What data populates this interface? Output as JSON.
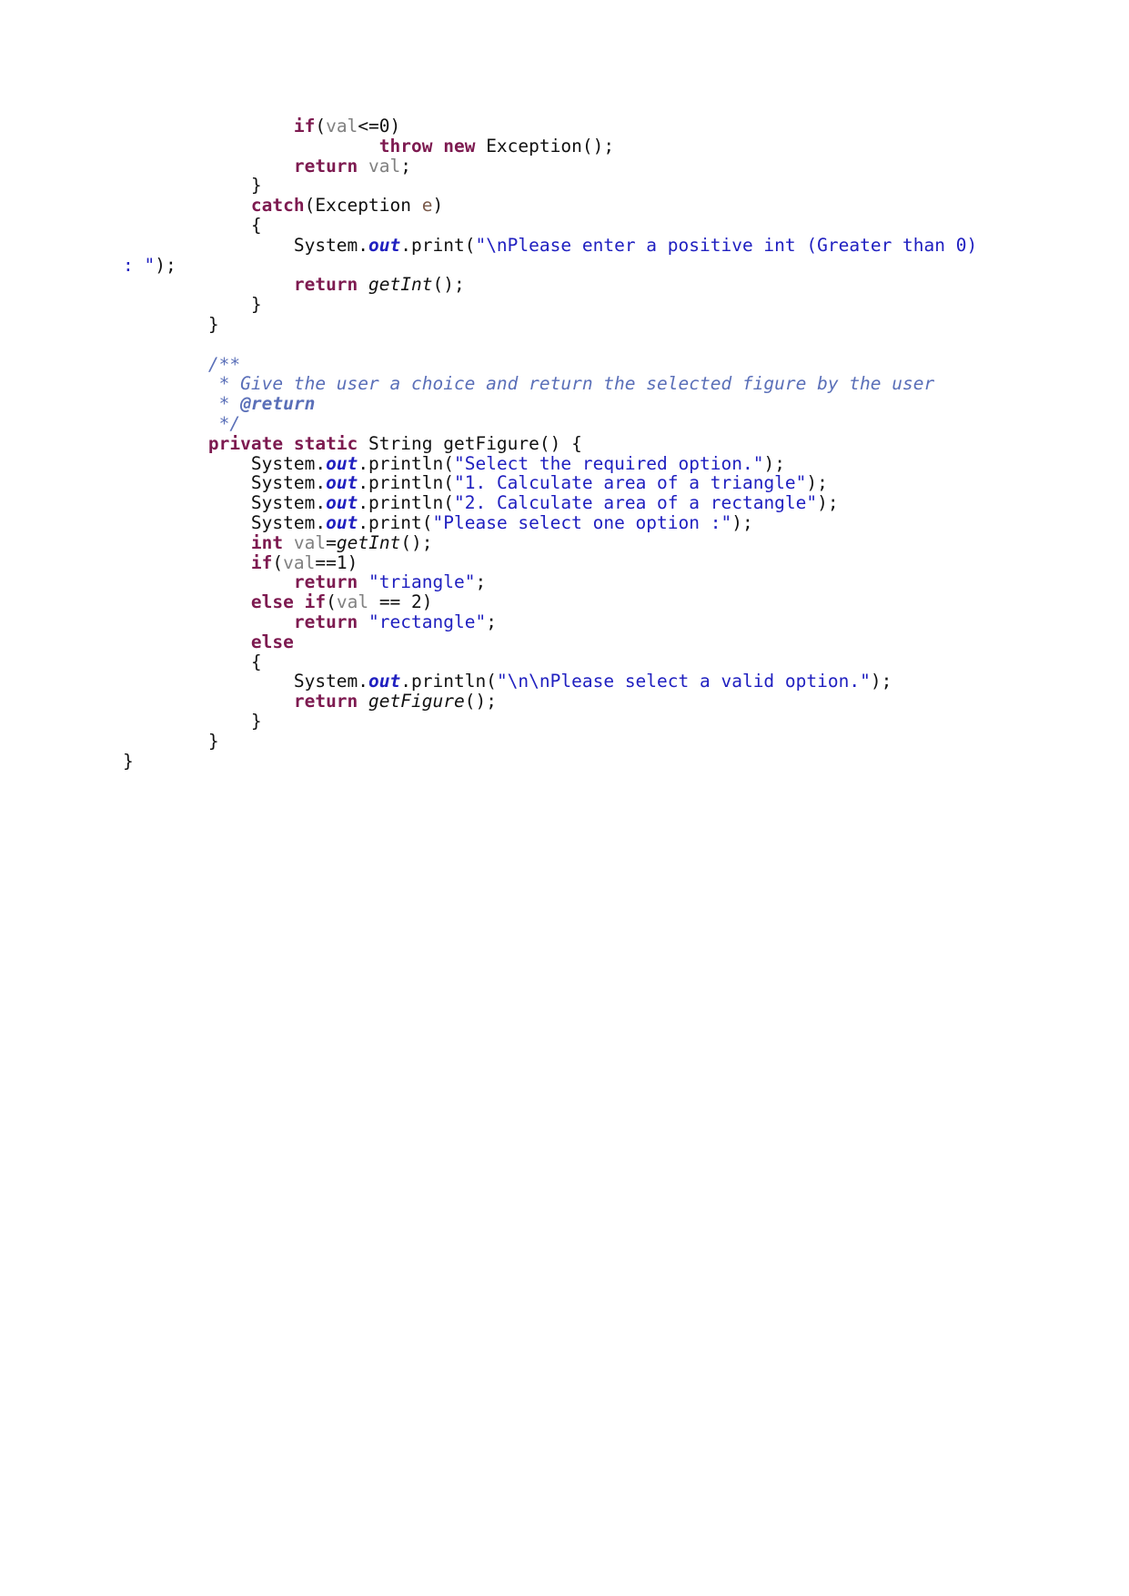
{
  "document": {
    "language": "java",
    "background_color": "#ffffff",
    "colors": {
      "keyword": "#7d1a50",
      "string": "#2020c0",
      "comment": "#5a6fb8",
      "identifier": "#808080",
      "plain": "#111111",
      "static_field": "#2020c0",
      "parameter": "#7a5a4a"
    }
  },
  "code": {
    "lines": [
      {
        "indent": 16,
        "tokens": [
          {
            "t": "if",
            "c": "kw"
          },
          {
            "t": "(",
            "c": "plain"
          },
          {
            "t": "val",
            "c": "id"
          },
          {
            "t": "<=0)",
            "c": "plain"
          }
        ]
      },
      {
        "indent": 24,
        "tokens": [
          {
            "t": "throw",
            "c": "kw"
          },
          {
            "t": " ",
            "c": "plain"
          },
          {
            "t": "new",
            "c": "kw"
          },
          {
            "t": " Exception();",
            "c": "plain"
          }
        ]
      },
      {
        "indent": 16,
        "tokens": [
          {
            "t": "return",
            "c": "kw"
          },
          {
            "t": " ",
            "c": "plain"
          },
          {
            "t": "val",
            "c": "id"
          },
          {
            "t": ";",
            "c": "plain"
          }
        ]
      },
      {
        "indent": 12,
        "tokens": [
          {
            "t": "}",
            "c": "plain"
          }
        ]
      },
      {
        "indent": 12,
        "tokens": [
          {
            "t": "catch",
            "c": "kw"
          },
          {
            "t": "(Exception ",
            "c": "plain"
          },
          {
            "t": "e",
            "c": "param"
          },
          {
            "t": ")",
            "c": "plain"
          }
        ]
      },
      {
        "indent": 12,
        "tokens": [
          {
            "t": "{",
            "c": "plain"
          }
        ]
      },
      {
        "indent": 16,
        "tokens": [
          {
            "t": "System.",
            "c": "plain"
          },
          {
            "t": "out",
            "c": "out"
          },
          {
            "t": ".print(",
            "c": "plain"
          },
          {
            "t": "\"\\nPlease enter a positive int (Greater than 0) : \"",
            "c": "str"
          },
          {
            "t": ");",
            "c": "plain"
          }
        ]
      },
      {
        "indent": 16,
        "tokens": [
          {
            "t": "return",
            "c": "kw"
          },
          {
            "t": " ",
            "c": "plain"
          },
          {
            "t": "getInt",
            "c": "mth"
          },
          {
            "t": "();",
            "c": "plain"
          }
        ]
      },
      {
        "indent": 12,
        "tokens": [
          {
            "t": "}",
            "c": "plain"
          }
        ]
      },
      {
        "indent": 8,
        "tokens": [
          {
            "t": "}",
            "c": "plain"
          }
        ]
      },
      {
        "indent": 0,
        "blank": true,
        "tokens": []
      },
      {
        "indent": 8,
        "tokens": [
          {
            "t": "/**",
            "c": "cmt"
          }
        ]
      },
      {
        "indent": 8,
        "tokens": [
          {
            "t": " * Give the user a choice and return the selected figure by the user",
            "c": "cmt"
          }
        ]
      },
      {
        "indent": 8,
        "tokens": [
          {
            "t": " * ",
            "c": "cmt"
          },
          {
            "t": "@return",
            "c": "cmttag"
          }
        ]
      },
      {
        "indent": 8,
        "tokens": [
          {
            "t": " */",
            "c": "cmt"
          }
        ]
      },
      {
        "indent": 8,
        "tokens": [
          {
            "t": "private",
            "c": "kw"
          },
          {
            "t": " ",
            "c": "plain"
          },
          {
            "t": "static",
            "c": "kw"
          },
          {
            "t": " String getFigure() {",
            "c": "plain"
          }
        ]
      },
      {
        "indent": 12,
        "tokens": [
          {
            "t": "System.",
            "c": "plain"
          },
          {
            "t": "out",
            "c": "out"
          },
          {
            "t": ".println(",
            "c": "plain"
          },
          {
            "t": "\"Select the required option.\"",
            "c": "str"
          },
          {
            "t": ");",
            "c": "plain"
          }
        ]
      },
      {
        "indent": 12,
        "tokens": [
          {
            "t": "System.",
            "c": "plain"
          },
          {
            "t": "out",
            "c": "out"
          },
          {
            "t": ".println(",
            "c": "plain"
          },
          {
            "t": "\"1. Calculate area of a triangle\"",
            "c": "str"
          },
          {
            "t": ");",
            "c": "plain"
          }
        ]
      },
      {
        "indent": 12,
        "tokens": [
          {
            "t": "System.",
            "c": "plain"
          },
          {
            "t": "out",
            "c": "out"
          },
          {
            "t": ".println(",
            "c": "plain"
          },
          {
            "t": "\"2. Calculate area of a rectangle\"",
            "c": "str"
          },
          {
            "t": ");",
            "c": "plain"
          }
        ]
      },
      {
        "indent": 12,
        "tokens": [
          {
            "t": "System.",
            "c": "plain"
          },
          {
            "t": "out",
            "c": "out"
          },
          {
            "t": ".print(",
            "c": "plain"
          },
          {
            "t": "\"Please select one option :\"",
            "c": "str"
          },
          {
            "t": ");",
            "c": "plain"
          }
        ]
      },
      {
        "indent": 12,
        "tokens": [
          {
            "t": "int",
            "c": "kw"
          },
          {
            "t": " ",
            "c": "plain"
          },
          {
            "t": "val",
            "c": "id"
          },
          {
            "t": "=",
            "c": "plain"
          },
          {
            "t": "getInt",
            "c": "mth"
          },
          {
            "t": "();",
            "c": "plain"
          }
        ]
      },
      {
        "indent": 12,
        "tokens": [
          {
            "t": "if",
            "c": "kw"
          },
          {
            "t": "(",
            "c": "plain"
          },
          {
            "t": "val",
            "c": "id"
          },
          {
            "t": "==1)",
            "c": "plain"
          }
        ]
      },
      {
        "indent": 16,
        "tokens": [
          {
            "t": "return",
            "c": "kw"
          },
          {
            "t": " ",
            "c": "plain"
          },
          {
            "t": "\"triangle\"",
            "c": "str"
          },
          {
            "t": ";",
            "c": "plain"
          }
        ]
      },
      {
        "indent": 12,
        "tokens": [
          {
            "t": "else",
            "c": "kw"
          },
          {
            "t": " ",
            "c": "plain"
          },
          {
            "t": "if",
            "c": "kw"
          },
          {
            "t": "(",
            "c": "plain"
          },
          {
            "t": "val",
            "c": "id"
          },
          {
            "t": " == 2)",
            "c": "plain"
          }
        ]
      },
      {
        "indent": 16,
        "tokens": [
          {
            "t": "return",
            "c": "kw"
          },
          {
            "t": " ",
            "c": "plain"
          },
          {
            "t": "\"rectangle\"",
            "c": "str"
          },
          {
            "t": ";",
            "c": "plain"
          }
        ]
      },
      {
        "indent": 12,
        "tokens": [
          {
            "t": "else",
            "c": "kw"
          }
        ]
      },
      {
        "indent": 12,
        "tokens": [
          {
            "t": "{",
            "c": "plain"
          }
        ]
      },
      {
        "indent": 16,
        "tokens": [
          {
            "t": "System.",
            "c": "plain"
          },
          {
            "t": "out",
            "c": "out"
          },
          {
            "t": ".println(",
            "c": "plain"
          },
          {
            "t": "\"\\n\\nPlease select a valid option.\"",
            "c": "str"
          },
          {
            "t": ");",
            "c": "plain"
          }
        ]
      },
      {
        "indent": 16,
        "tokens": [
          {
            "t": "return",
            "c": "kw"
          },
          {
            "t": " ",
            "c": "plain"
          },
          {
            "t": "getFigure",
            "c": "mth"
          },
          {
            "t": "();",
            "c": "plain"
          }
        ]
      },
      {
        "indent": 12,
        "tokens": [
          {
            "t": "}",
            "c": "plain"
          }
        ]
      },
      {
        "indent": 8,
        "tokens": [
          {
            "t": "}",
            "c": "plain"
          }
        ]
      },
      {
        "indent": 0,
        "tokens": [
          {
            "t": "}",
            "c": "plain"
          }
        ]
      }
    ],
    "plain_text": "\t\t\tif(val<=0)\n\t\t\t\tthrow new Exception();\n\t\t\treturn val;\n\t\t}\n\t\tcatch(Exception e)\n\t\t{\n\t\t\tSystem.out.print(\"\\nPlease enter a positive int (Greater than 0) : \");\n\t\t\treturn getInt();\n\t\t}\n\t}\n\n\t/**\n\t * Give the user a choice and return the selected figure by the user\n\t * @return\n\t */\n\tprivate static String getFigure() {\n\t\tSystem.out.println(\"Select the required option.\");\n\t\tSystem.out.println(\"1. Calculate area of a triangle\");\n\t\tSystem.out.println(\"2. Calculate area of a rectangle\");\n\t\tSystem.out.print(\"Please select one option :\");\n\t\tint val=getInt();\n\t\tif(val==1)\n\t\t\treturn \"triangle\";\n\t\telse if(val == 2)\n\t\t\treturn \"rectangle\";\n\t\telse\n\t\t{\n\t\t\tSystem.out.println(\"\\n\\nPlease select a valid option.\");\n\t\t\treturn getFigure();\n\t\t}\n\t}\n}"
  }
}
